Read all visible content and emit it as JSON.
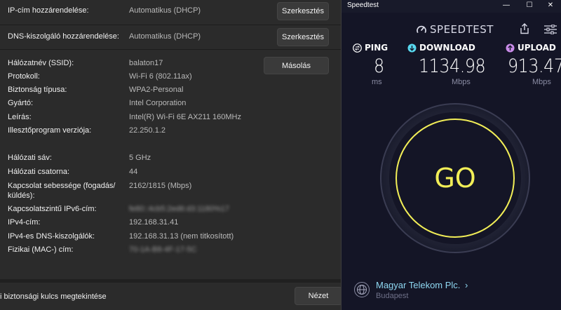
{
  "settings": {
    "ip_assign": {
      "label": "IP-cím hozzárendelése:",
      "value": "Automatikus (DHCP)",
      "button": "Szerkesztés"
    },
    "dns_assign": {
      "label": "DNS-kiszolgáló hozzárendelése:",
      "value": "Automatikus (DHCP)",
      "button": "Szerkesztés"
    },
    "copy_button": "Másolás",
    "properties": [
      {
        "label": "Hálózatnév (SSID):",
        "value": "balaton17"
      },
      {
        "label": "Protokoll:",
        "value": "Wi-Fi 6 (802.11ax)"
      },
      {
        "label": "Biztonság típusa:",
        "value": "WPA2-Personal"
      },
      {
        "label": "Gyártó:",
        "value": "Intel Corporation"
      },
      {
        "label": "Leírás:",
        "value": "Intel(R) Wi-Fi 6E AX211 160MHz"
      },
      {
        "label": "Illesztőprogram verziója:",
        "value": "22.250.1.2"
      },
      {
        "label": "Hálózati sáv:",
        "value": "5 GHz"
      },
      {
        "label": "Hálózati csatorna:",
        "value": "44"
      },
      {
        "label_line1": "Kapcsolat sebessége (fogadás/",
        "label_line2": "küldés):",
        "value": "2162/1815 (Mbps)"
      },
      {
        "label": "Kapcsolatszintű IPv6-cím:",
        "value": "fe80::4cb5:2ed6:d3:1180%17"
      },
      {
        "label": "IPv4-cím:",
        "value": "192.168.31.41"
      },
      {
        "label": "IPv4-es DNS-kiszolgálók:",
        "value": "192.168.31.13 (nem titkosított)"
      },
      {
        "label": "Fizikai (MAC-) cím:",
        "value": "70-1A-B8-4F-17-5C"
      }
    ],
    "security_key": {
      "label": "i biztonsági kulcs megtekintése",
      "button": "Nézet"
    }
  },
  "speedtest": {
    "window_title": "Speedtest",
    "window_controls": {
      "minimize": "—",
      "maximize": "☐",
      "close": "✕"
    },
    "brand": "SPEEDTEST",
    "ping": {
      "label": "PING",
      "value": "8",
      "unit": "ms"
    },
    "download": {
      "label": "DOWNLOAD",
      "value": "1134.98",
      "unit": "Mbps"
    },
    "upload": {
      "label": "UPLOAD",
      "value": "913.47",
      "unit": "Mbps"
    },
    "go_label": "GO",
    "isp": {
      "name": "Magyar Telekom Plc.",
      "location": "Budapest"
    },
    "colors": {
      "go_ring": "#f2ee57",
      "download_icon": "#58d8ef",
      "upload_icon": "#c98be8",
      "isp_link": "#8fd8f2"
    }
  }
}
